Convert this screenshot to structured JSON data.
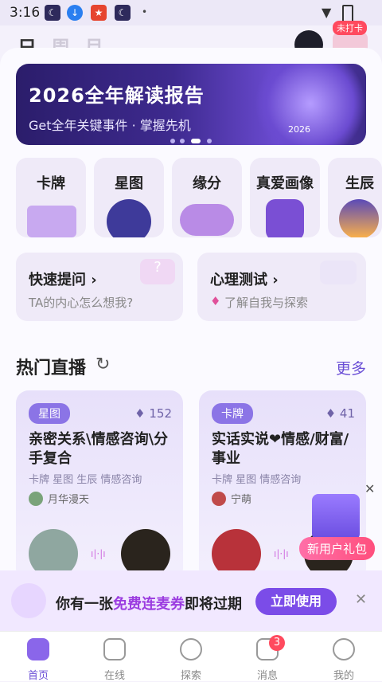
{
  "status_bar": {
    "time": "3:16"
  },
  "top_tabs": [
    "日",
    "周",
    "月"
  ],
  "checkin_badge": "未打卡",
  "banner": {
    "title": "2026全年解读报告",
    "subtitle": "Get全年关键事件 · 掌握先机",
    "art_text": "2026"
  },
  "categories": [
    "卡牌",
    "星图",
    "缘分",
    "真爱画像",
    "生辰"
  ],
  "quick_cards": [
    {
      "title": "快速提问 ›",
      "subtitle": "TA的内心怎么想我?"
    },
    {
      "title": "心理测试 ›",
      "subtitle": "了解自我与探索"
    }
  ],
  "section": {
    "title": "热门直播",
    "more": "更多"
  },
  "live_cards": [
    {
      "badge": "星图",
      "heat": "152",
      "title": "亲密关系\\情感咨询\\分手复合",
      "tags": "卡牌  星图  生辰  情感咨询",
      "host": "月华漫天"
    },
    {
      "badge": "卡牌",
      "heat": "41",
      "title": "实话实说❤情感/财富/事业",
      "tags": "卡牌  星图  情感咨询",
      "host": "宁萌"
    }
  ],
  "gift": {
    "label": "新用户礼包",
    "close": "✕"
  },
  "coupon": {
    "prefix": "你有一张",
    "highlight": "免费连麦券",
    "suffix": "即将过期",
    "button": "立即使用",
    "close": "✕"
  },
  "nav": [
    {
      "label": "首页",
      "icon": "home-icon"
    },
    {
      "label": "在线",
      "icon": "online-icon"
    },
    {
      "label": "探索",
      "icon": "explore-icon"
    },
    {
      "label": "消息",
      "icon": "message-icon"
    },
    {
      "label": "我的",
      "icon": "profile-icon"
    }
  ],
  "message_count": "3",
  "colors": {
    "accent": "#6b4fd6",
    "highlight": "#9b3ce0",
    "badge_red": "#ff4a5e"
  }
}
